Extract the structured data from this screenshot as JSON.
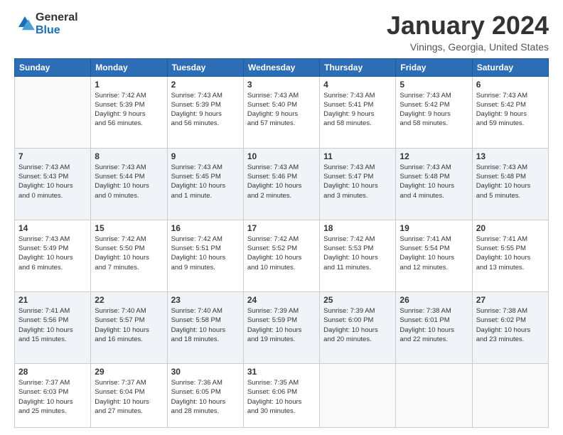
{
  "header": {
    "logo_line1": "General",
    "logo_line2": "Blue",
    "month": "January 2024",
    "location": "Vinings, Georgia, United States"
  },
  "days_of_week": [
    "Sunday",
    "Monday",
    "Tuesday",
    "Wednesday",
    "Thursday",
    "Friday",
    "Saturday"
  ],
  "weeks": [
    [
      {
        "day": "",
        "info": ""
      },
      {
        "day": "1",
        "info": "Sunrise: 7:42 AM\nSunset: 5:39 PM\nDaylight: 9 hours\nand 56 minutes."
      },
      {
        "day": "2",
        "info": "Sunrise: 7:43 AM\nSunset: 5:39 PM\nDaylight: 9 hours\nand 56 minutes."
      },
      {
        "day": "3",
        "info": "Sunrise: 7:43 AM\nSunset: 5:40 PM\nDaylight: 9 hours\nand 57 minutes."
      },
      {
        "day": "4",
        "info": "Sunrise: 7:43 AM\nSunset: 5:41 PM\nDaylight: 9 hours\nand 58 minutes."
      },
      {
        "day": "5",
        "info": "Sunrise: 7:43 AM\nSunset: 5:42 PM\nDaylight: 9 hours\nand 58 minutes."
      },
      {
        "day": "6",
        "info": "Sunrise: 7:43 AM\nSunset: 5:42 PM\nDaylight: 9 hours\nand 59 minutes."
      }
    ],
    [
      {
        "day": "7",
        "info": "Sunrise: 7:43 AM\nSunset: 5:43 PM\nDaylight: 10 hours\nand 0 minutes."
      },
      {
        "day": "8",
        "info": "Sunrise: 7:43 AM\nSunset: 5:44 PM\nDaylight: 10 hours\nand 0 minutes."
      },
      {
        "day": "9",
        "info": "Sunrise: 7:43 AM\nSunset: 5:45 PM\nDaylight: 10 hours\nand 1 minute."
      },
      {
        "day": "10",
        "info": "Sunrise: 7:43 AM\nSunset: 5:46 PM\nDaylight: 10 hours\nand 2 minutes."
      },
      {
        "day": "11",
        "info": "Sunrise: 7:43 AM\nSunset: 5:47 PM\nDaylight: 10 hours\nand 3 minutes."
      },
      {
        "day": "12",
        "info": "Sunrise: 7:43 AM\nSunset: 5:48 PM\nDaylight: 10 hours\nand 4 minutes."
      },
      {
        "day": "13",
        "info": "Sunrise: 7:43 AM\nSunset: 5:48 PM\nDaylight: 10 hours\nand 5 minutes."
      }
    ],
    [
      {
        "day": "14",
        "info": "Sunrise: 7:43 AM\nSunset: 5:49 PM\nDaylight: 10 hours\nand 6 minutes."
      },
      {
        "day": "15",
        "info": "Sunrise: 7:42 AM\nSunset: 5:50 PM\nDaylight: 10 hours\nand 7 minutes."
      },
      {
        "day": "16",
        "info": "Sunrise: 7:42 AM\nSunset: 5:51 PM\nDaylight: 10 hours\nand 9 minutes."
      },
      {
        "day": "17",
        "info": "Sunrise: 7:42 AM\nSunset: 5:52 PM\nDaylight: 10 hours\nand 10 minutes."
      },
      {
        "day": "18",
        "info": "Sunrise: 7:42 AM\nSunset: 5:53 PM\nDaylight: 10 hours\nand 11 minutes."
      },
      {
        "day": "19",
        "info": "Sunrise: 7:41 AM\nSunset: 5:54 PM\nDaylight: 10 hours\nand 12 minutes."
      },
      {
        "day": "20",
        "info": "Sunrise: 7:41 AM\nSunset: 5:55 PM\nDaylight: 10 hours\nand 13 minutes."
      }
    ],
    [
      {
        "day": "21",
        "info": "Sunrise: 7:41 AM\nSunset: 5:56 PM\nDaylight: 10 hours\nand 15 minutes."
      },
      {
        "day": "22",
        "info": "Sunrise: 7:40 AM\nSunset: 5:57 PM\nDaylight: 10 hours\nand 16 minutes."
      },
      {
        "day": "23",
        "info": "Sunrise: 7:40 AM\nSunset: 5:58 PM\nDaylight: 10 hours\nand 18 minutes."
      },
      {
        "day": "24",
        "info": "Sunrise: 7:39 AM\nSunset: 5:59 PM\nDaylight: 10 hours\nand 19 minutes."
      },
      {
        "day": "25",
        "info": "Sunrise: 7:39 AM\nSunset: 6:00 PM\nDaylight: 10 hours\nand 20 minutes."
      },
      {
        "day": "26",
        "info": "Sunrise: 7:38 AM\nSunset: 6:01 PM\nDaylight: 10 hours\nand 22 minutes."
      },
      {
        "day": "27",
        "info": "Sunrise: 7:38 AM\nSunset: 6:02 PM\nDaylight: 10 hours\nand 23 minutes."
      }
    ],
    [
      {
        "day": "28",
        "info": "Sunrise: 7:37 AM\nSunset: 6:03 PM\nDaylight: 10 hours\nand 25 minutes."
      },
      {
        "day": "29",
        "info": "Sunrise: 7:37 AM\nSunset: 6:04 PM\nDaylight: 10 hours\nand 27 minutes."
      },
      {
        "day": "30",
        "info": "Sunrise: 7:36 AM\nSunset: 6:05 PM\nDaylight: 10 hours\nand 28 minutes."
      },
      {
        "day": "31",
        "info": "Sunrise: 7:35 AM\nSunset: 6:06 PM\nDaylight: 10 hours\nand 30 minutes."
      },
      {
        "day": "",
        "info": ""
      },
      {
        "day": "",
        "info": ""
      },
      {
        "day": "",
        "info": ""
      }
    ]
  ]
}
